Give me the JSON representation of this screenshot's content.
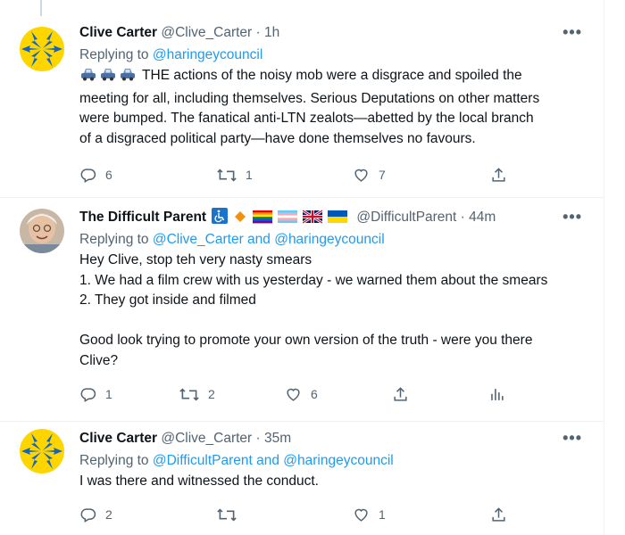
{
  "tweets": [
    {
      "name": "Clive Carter",
      "handle": "@Clive_Carter",
      "time": "1h",
      "reply_prefix": "Replying to ",
      "reply_to": "@haringeycouncil",
      "lines": [
        "THE actions of the noisy mob were a disgrace and spoiled the",
        "meeting for all, including themselves. Serious Deputations on other matters",
        "were bumped. The fanatical anti-LTN zealots—abetted by the local branch",
        "of a disgraced political party—have done themselves no favours."
      ],
      "emoji_prefix": "car-icon x3",
      "counts": {
        "replies": "6",
        "retweets": "1",
        "likes": "7"
      }
    },
    {
      "name": "The Difficult Parent",
      "handle": "@DifficultParent",
      "time": "44m",
      "reply_prefix": "Replying to ",
      "reply_to": "@Clive_Carter and @haringeycouncil",
      "lines": [
        "Hey Clive, stop teh very nasty smears",
        "1. We had a film crew with us yesterday - we warned them about the smears",
        "2. They got inside and filmed",
        "",
        "Good look trying to promote your own version of the truth - were you there",
        "Clive?"
      ],
      "badges": [
        "wheelchair-icon",
        "orange-diamond-icon",
        "rainbow-flag-icon",
        "trans-flag-icon",
        "uk-flag-icon",
        "ukraine-flag-icon"
      ],
      "counts": {
        "replies": "1",
        "retweets": "2",
        "likes": "6"
      }
    },
    {
      "name": "Clive Carter",
      "handle": "@Clive_Carter",
      "time": "35m",
      "reply_prefix": "Replying to ",
      "reply_to": "@DifficultParent and @haringeycouncil",
      "lines": [
        "I was there and witnessed the conduct."
      ],
      "counts": {
        "replies": "2",
        "retweets": "",
        "likes": "1"
      }
    }
  ],
  "separator": "·",
  "more_label": "•••",
  "colors": {
    "link": "#1d9bf0",
    "muted": "#536471",
    "text": "#0f1419",
    "border": "#eff3f4"
  }
}
